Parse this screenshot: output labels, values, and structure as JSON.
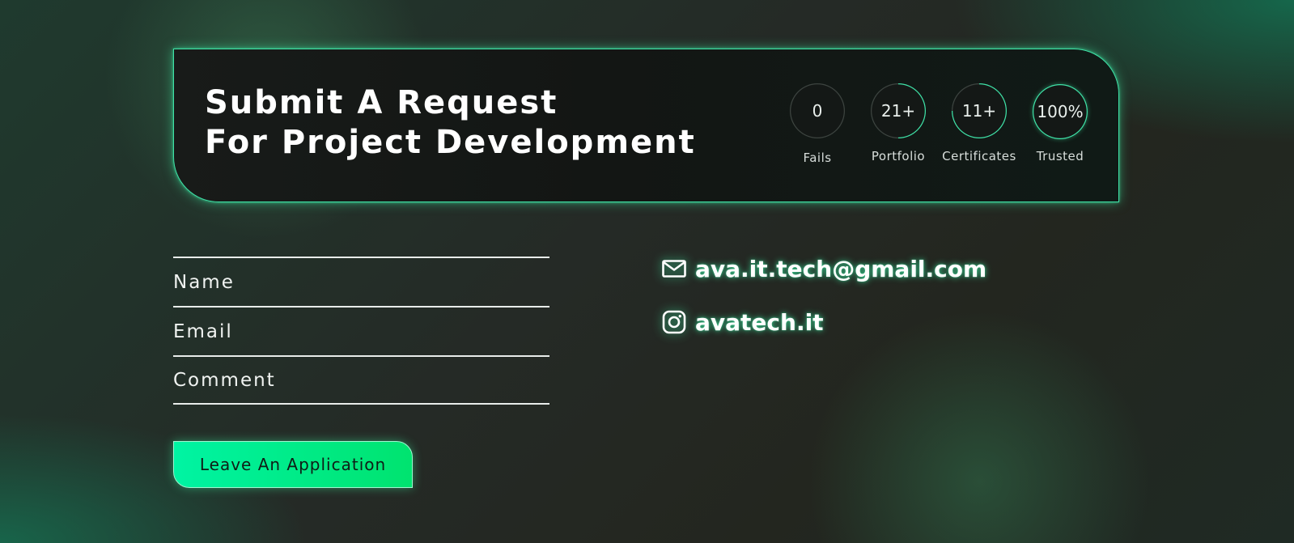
{
  "hero": {
    "title_line1": "Submit A Request",
    "title_line2": "For Project Development"
  },
  "stats": [
    {
      "value": "0",
      "label": "Fails",
      "progress": 0
    },
    {
      "value": "21+",
      "label": "Portfolio",
      "progress": 0.5
    },
    {
      "value": "11+",
      "label": "Certificates",
      "progress": 0.75
    },
    {
      "value": "100%",
      "label": "Trusted",
      "progress": 1
    }
  ],
  "form": {
    "name_placeholder": "Name",
    "email_placeholder": "Email",
    "comment_placeholder": "Comment",
    "submit_label": "Leave An Application"
  },
  "contacts": {
    "email": "ava.it.tech@gmail.com",
    "instagram": "avatech.it",
    "email_icon": "mail-icon",
    "instagram_icon": "instagram-icon"
  },
  "colors": {
    "accent": "#3fe3a8",
    "button_start": "#00f4a3",
    "button_end": "#00e36f",
    "ring_track": "#3d4440"
  }
}
